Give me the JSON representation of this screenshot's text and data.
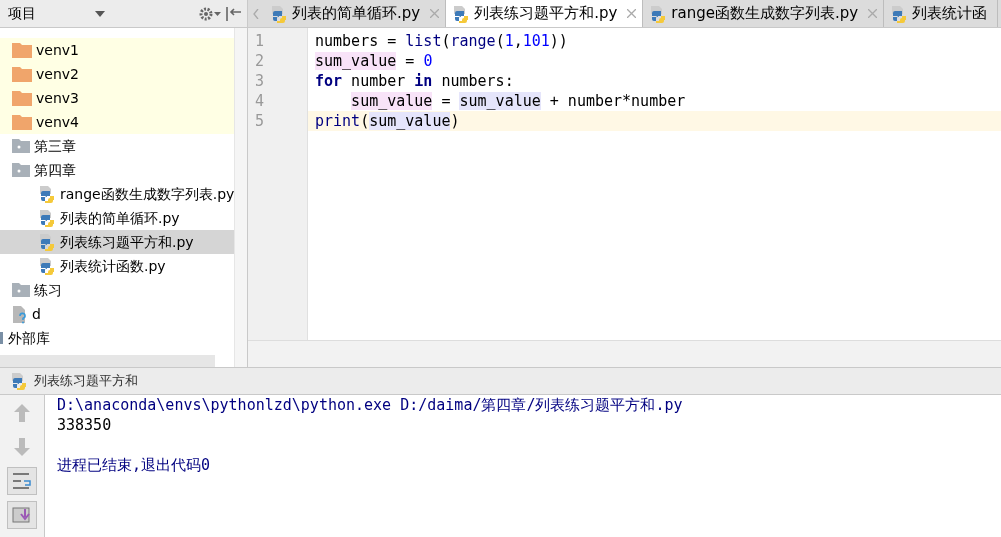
{
  "sidebar": {
    "title": "项目",
    "tree": [
      {
        "label": "venv1",
        "kind": "excluded_folder"
      },
      {
        "label": "venv2",
        "kind": "excluded_folder"
      },
      {
        "label": "venv3",
        "kind": "excluded_folder"
      },
      {
        "label": "venv4",
        "kind": "excluded_folder"
      },
      {
        "label": "第三章",
        "kind": "folder"
      },
      {
        "label": "第四章",
        "kind": "folder",
        "children": [
          {
            "label": "range函数生成数字列表.py",
            "kind": "python_file",
            "selected": false
          },
          {
            "label": "列表的简单循环.py",
            "kind": "python_file",
            "selected": false
          },
          {
            "label": "列表练习题平方和.py",
            "kind": "python_file",
            "selected": true
          },
          {
            "label": "列表统计函数.py",
            "kind": "python_file",
            "selected": false
          }
        ]
      },
      {
        "label": "练习",
        "kind": "folder"
      },
      {
        "label": "d",
        "kind": "unknown_file"
      }
    ],
    "libraries": "外部库"
  },
  "tabs": [
    {
      "label": "列表的简单循环.py",
      "selected": false,
      "closable": true
    },
    {
      "label": "列表练习题平方和.py",
      "selected": true,
      "closable": true
    },
    {
      "label": "range函数生成数字列表.py",
      "selected": false,
      "closable": true
    },
    {
      "label": "列表统计函",
      "selected": false
    }
  ],
  "editor": {
    "lines": [
      {
        "number": "1",
        "current": false,
        "tokens": [
          {
            "text": "numbers = ",
            "kind": "plain"
          },
          {
            "text": "list",
            "kind": "builtin"
          },
          {
            "text": "(",
            "kind": "plain"
          },
          {
            "text": "range",
            "kind": "builtin"
          },
          {
            "text": "(",
            "kind": "plain"
          },
          {
            "text": "1",
            "kind": "number"
          },
          {
            "text": ",",
            "kind": "plain"
          },
          {
            "text": "101",
            "kind": "number"
          },
          {
            "text": "))",
            "kind": "plain"
          }
        ]
      },
      {
        "number": "2",
        "current": false,
        "tokens": [
          {
            "text": "sum_value",
            "kind": "var_write"
          },
          {
            "text": " = ",
            "kind": "plain"
          },
          {
            "text": "0",
            "kind": "number"
          }
        ]
      },
      {
        "number": "3",
        "current": false,
        "tokens": [
          {
            "text": "for",
            "kind": "keyword"
          },
          {
            "text": " number ",
            "kind": "plain"
          },
          {
            "text": "in",
            "kind": "keyword"
          },
          {
            "text": " numbers:",
            "kind": "plain"
          }
        ]
      },
      {
        "number": "4",
        "current": false,
        "tokens": [
          {
            "kind": "indent"
          },
          {
            "text": "sum_value",
            "kind": "var_write"
          },
          {
            "text": " = ",
            "kind": "plain"
          },
          {
            "text": "sum_value",
            "kind": "var_read"
          },
          {
            "text": " + number*number",
            "kind": "plain"
          }
        ]
      },
      {
        "number": "5",
        "current": true,
        "tokens": [
          {
            "text": "print",
            "kind": "builtin"
          },
          {
            "text": "(",
            "kind": "plain"
          },
          {
            "text": "sum_value",
            "kind": "var_read"
          },
          {
            "text": ")",
            "kind": "plain"
          }
        ]
      }
    ]
  },
  "run": {
    "title": "列表练习题平方和",
    "output": [
      {
        "text": "D:\\anaconda\\envs\\pythonlzd\\python.exe D:/daima/第四章/列表练习题平方和.py",
        "kind": "system"
      },
      {
        "text": "338350",
        "kind": "stdout"
      },
      {
        "text": "进程已结束,退出代码0",
        "kind": "exit"
      }
    ]
  }
}
